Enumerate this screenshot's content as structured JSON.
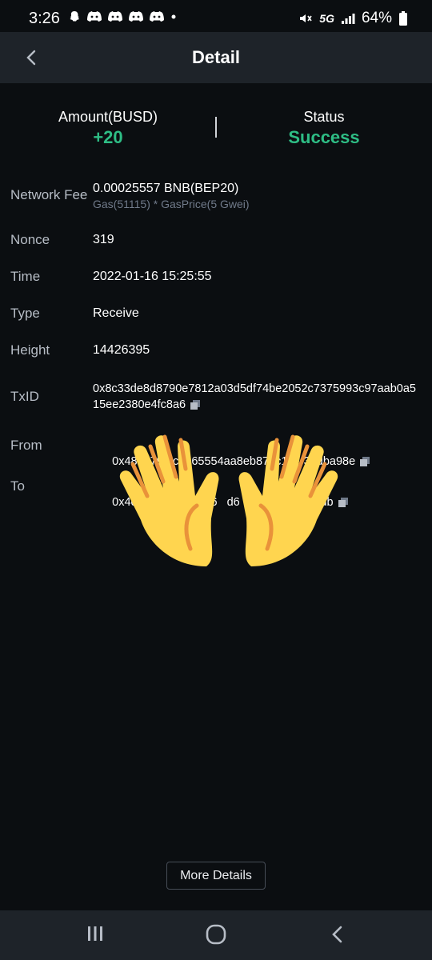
{
  "status_bar": {
    "time": "3:26",
    "network": "5G",
    "battery": "64%",
    "icons": [
      "snapchat-icon",
      "discord-icon",
      "discord-icon",
      "discord-icon",
      "discord-icon",
      "dot-icon",
      "mute-icon",
      "signal-icon",
      "battery-icon"
    ]
  },
  "header": {
    "title": "Detail"
  },
  "summary": {
    "amount_label": "Amount(BUSD)",
    "amount_value": "+20",
    "status_label": "Status",
    "status_value": "Success",
    "accent_color": "#2ebd85"
  },
  "details": {
    "network_fee": {
      "label": "Network Fee",
      "value": "0.00025557 BNB(BEP20)",
      "sub": "Gas(51115) * GasPrice(5 Gwei)"
    },
    "nonce": {
      "label": "Nonce",
      "value": "319"
    },
    "time": {
      "label": "Time",
      "value": "2022-01-16 15:25:55"
    },
    "type": {
      "label": "Type",
      "value": "Receive"
    },
    "height": {
      "label": "Height",
      "value": "14426395"
    },
    "txid": {
      "label": "TxID",
      "value": "0x8c33de8d8790e7812a03d5df74be2052c7375993c97aab0a515ee2380e4fc8a6"
    },
    "from": {
      "label": "From",
      "value": "0x48e379f6c    65554aa8eb87ac1d   3edba98e"
    },
    "to": {
      "label": "To",
      "value": "0x4c                     46   d6     3                2db"
    }
  },
  "more_details_label": "More Details",
  "overlay": {
    "emoji": "raising-hands-emoji"
  },
  "nav": {
    "items": [
      "recents-icon",
      "home-icon",
      "back-icon"
    ]
  }
}
